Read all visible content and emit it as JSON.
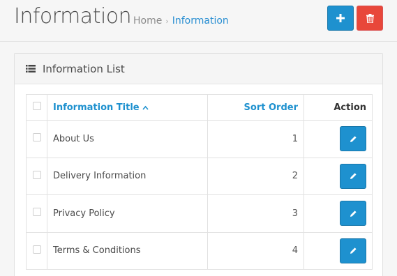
{
  "header": {
    "title": "Information",
    "breadcrumb": [
      "Home",
      "Information"
    ],
    "add_icon": "plus-icon",
    "delete_icon": "trash-icon"
  },
  "panel": {
    "title": "Information List",
    "icon": "list-icon"
  },
  "table": {
    "columns": {
      "title": "Information Title",
      "sort_order": "Sort Order",
      "action": "Action"
    },
    "rows": [
      {
        "title": "About Us",
        "sort_order": "1"
      },
      {
        "title": "Delivery Information",
        "sort_order": "2"
      },
      {
        "title": "Privacy Policy",
        "sort_order": "3"
      },
      {
        "title": "Terms & Conditions",
        "sort_order": "4"
      }
    ]
  },
  "colors": {
    "primary": "#1e91cf",
    "danger": "#e8473a"
  }
}
